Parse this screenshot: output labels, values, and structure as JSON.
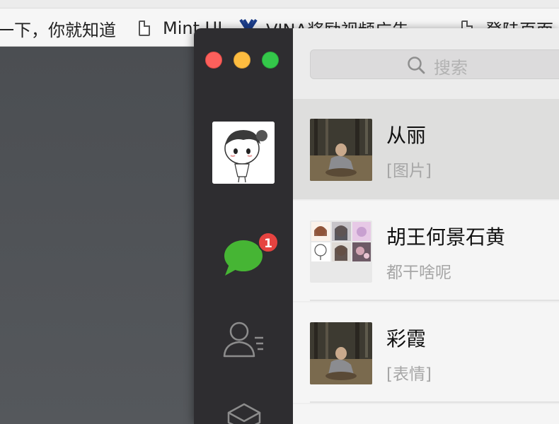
{
  "browser": {
    "bookmarks": [
      {
        "label": "一下，你就知道",
        "icon": "none"
      },
      {
        "label": "Mint UI",
        "icon": "page-icon"
      },
      {
        "label": "VINA奖励视频广告",
        "icon": "vina-logo"
      },
      {
        "label": "登陆页面",
        "icon": "page-icon"
      }
    ]
  },
  "wechat": {
    "badge_count": "1",
    "search": {
      "placeholder": "搜索"
    },
    "conversations": [
      {
        "name": "从丽",
        "preview": "[图片]",
        "active": true
      },
      {
        "name": "胡王何景石黄",
        "preview": "都干啥呢",
        "active": false
      },
      {
        "name": "彩霞",
        "preview": "[表情]",
        "active": false
      }
    ],
    "colors": {
      "sidebar": "#2e2d30",
      "chat_icon": "#46b534",
      "badge": "#e64340",
      "close": "#fc605c",
      "minimize": "#fdbc40",
      "maximize": "#34c84a"
    }
  }
}
